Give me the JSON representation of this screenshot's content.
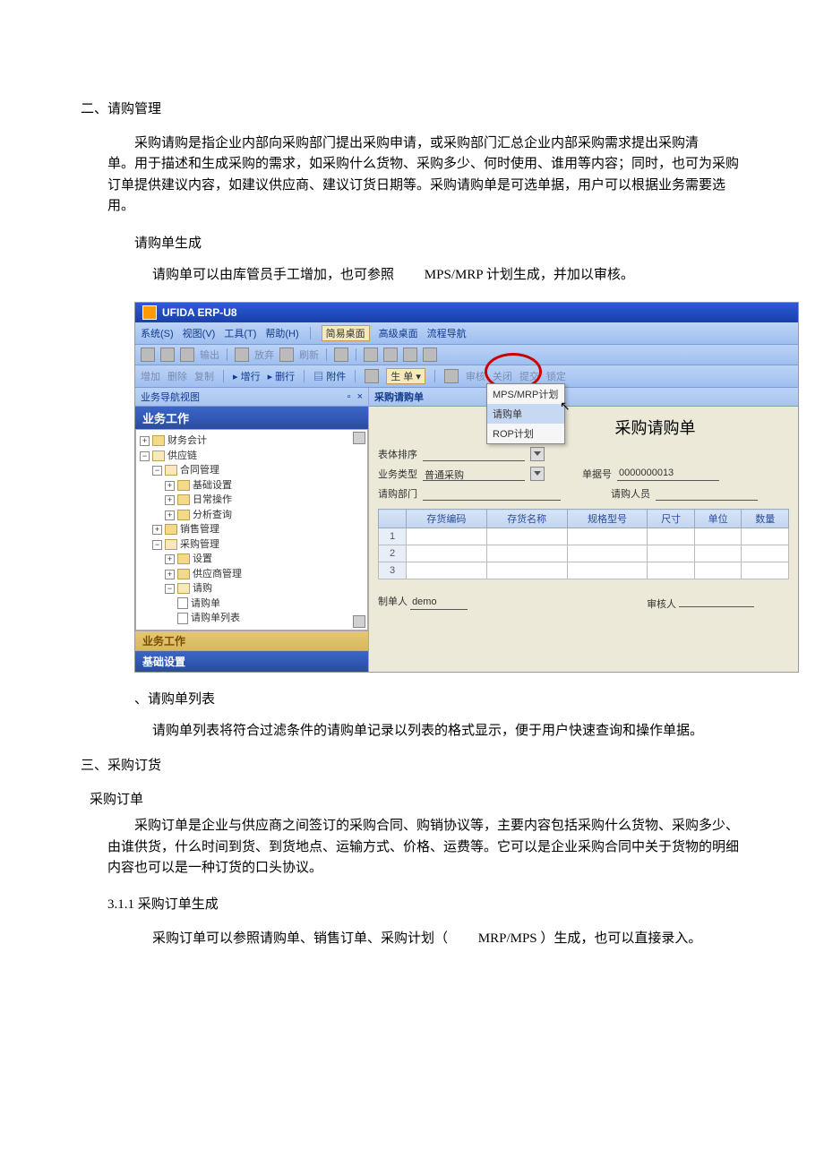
{
  "doc": {
    "section2_title": "二、请购管理",
    "section2_para": "采购请购是指企业内部向采购部门提出采购申请，或采购部门汇总企业内部采购需求提出采购清  单。用于描述和生成采购的需求，如采购什么货物、采购多少、何时使用、谁用等内容；同时，也可为采购订单提供建议内容，如建议供应商、建议订货日期等。采购请购单是可选单据，用户可以根据业务需要选用。",
    "req_gen_title": "请购单生成",
    "req_gen_body_a": "请购单可以由库管员手工增加，也可参照  ",
    "req_gen_body_b": "MPS/MRP",
    "req_gen_body_c": " 计划生成，并加以审核。",
    "req_list_title": "、请购单列表",
    "req_list_body": "请购单列表将符合过滤条件的请购单记录以列表的格式显示，便于用户快速查询和操作单据。",
    "section3_title": "三、采购订货",
    "po_title": "采购订单",
    "po_para": "采购订单是企业与供应商之间签订的采购合同、购销协议等，主要内容包括采购什么货物、采购多少、由谁供货，什么时间到货、到货地点、运输方式、价格、运费等。它可以是企业采购合同中关于货物的明细内容也可以是一种订货的口头协议。",
    "po_gen_num": "3.1.1",
    "po_gen_title": " 采购订单生成",
    "po_gen_body_a": "采购订单可以参照请购单、销售订单、采购计划（  ",
    "po_gen_body_b": "MRP/MPS",
    "po_gen_body_c": "）生成，也可以直接录入。"
  },
  "shot": {
    "title": "UFIDA ERP-U8",
    "menus": {
      "sys": "系统(S)",
      "view": "视图(V)",
      "tool": "工具(T)",
      "help": "帮助(H)",
      "simple": "简易桌面",
      "classic": "高级桌面",
      "flow": "流程导航"
    },
    "tb1": {
      "print": "输出",
      "giveup": "放弃",
      "refresh": "刷新"
    },
    "tb2": {
      "add": "增加",
      "del": "删除",
      "copy": "复制",
      "insrow": "增行",
      "delrow": "删行",
      "attach": "附件",
      "gen": "生 单 ▾",
      "audit": "审核",
      "close": "关闭",
      "commit": "提交",
      "lock": "锁定"
    },
    "gen_menu": {
      "mps": "MPS/MRP计划",
      "req": "请购单",
      "rop": "ROP计划"
    },
    "nav": {
      "header": "业务导航视图",
      "title": "业务工作",
      "items": {
        "fin": "财务会计",
        "scm": "供应链",
        "contract": "合同管理",
        "base": "基础设置",
        "daily": "日常操作",
        "query": "分析查询",
        "sales": "销售管理",
        "purchase": "采购管理",
        "setup": "设置",
        "vendor": "供应商管理",
        "req": "请购",
        "reqbill": "请购单",
        "reqlist": "请购单列表"
      },
      "tab_a": "业务工作",
      "tab_b": "基础设置"
    },
    "main": {
      "tab": "采购请购单",
      "form_title": "采购请购单",
      "sort_label": "表体排序",
      "biztype_label": "业务类型",
      "biztype_value": "普通采购",
      "billno_label": "单据号",
      "billno_value": "0000000013",
      "dept_label": "请购部门",
      "person_label": "请购人员",
      "cols": {
        "code": "存货编码",
        "name": "存货名称",
        "spec": "规格型号",
        "size": "尺寸",
        "unit": "单位",
        "qty": "数量"
      },
      "rows": [
        "1",
        "2",
        "3"
      ],
      "maker_label": "制单人",
      "maker_value": "demo",
      "auditor_label": "审核人"
    }
  }
}
